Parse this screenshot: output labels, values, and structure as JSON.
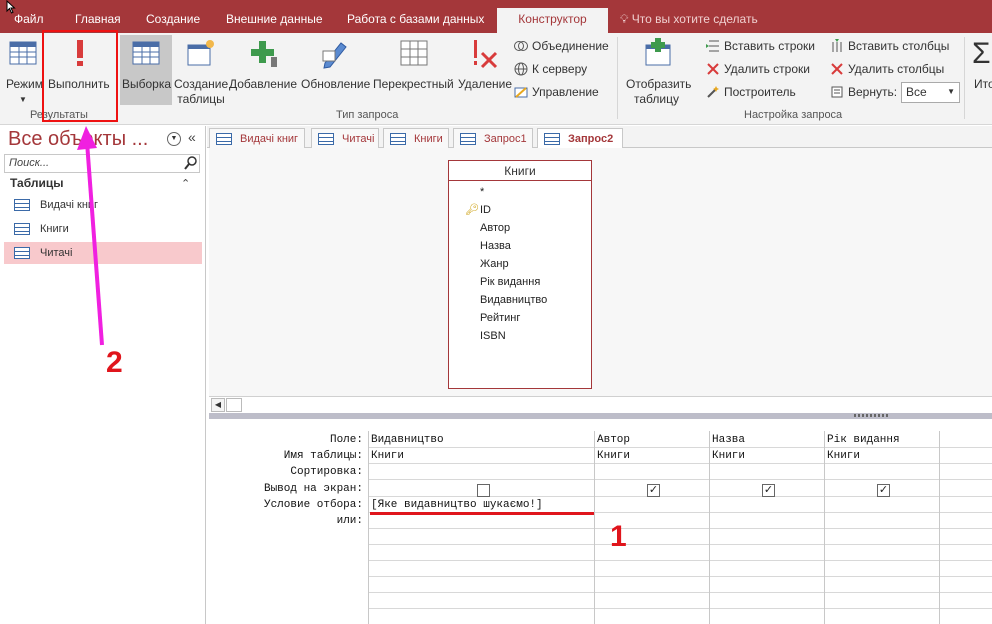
{
  "menu": {
    "tabs": [
      "Файл",
      "Главная",
      "Создание",
      "Внешние данные",
      "Работа с базами данных"
    ],
    "active_tab": "Конструктор",
    "tell_me": "Что вы хотите сделать"
  },
  "ribbon": {
    "results": {
      "view_label": "Режим",
      "run_label": "Выполнить",
      "group": "Результаты"
    },
    "query_type": {
      "select": "Выборка",
      "make_table_1": "Создание",
      "make_table_2": "таблицы",
      "append": "Добавление",
      "update": "Обновление",
      "crosstab": "Перекрестный",
      "delete": "Удаление",
      "union": "Объединение",
      "passthrough": "К серверу",
      "ddl": "Управление",
      "group": "Тип запроса"
    },
    "setup": {
      "show_table_1": "Отобразить",
      "show_table_2": "таблицу",
      "insert_rows": "Вставить строки",
      "delete_rows": "Удалить строки",
      "builder": "Построитель",
      "insert_cols": "Вставить столбцы",
      "delete_cols": "Удалить столбцы",
      "return_label": "Вернуть:",
      "return_value": "Все",
      "group": "Настройка запроса"
    },
    "totals": "Ито"
  },
  "nav": {
    "title": "Все объекты ...",
    "search_placeholder": "Поиск...",
    "section": "Таблицы",
    "items": [
      "Видачі книг",
      "Книги",
      "Читачі"
    ]
  },
  "doc_tabs": [
    "Видачі книг",
    "Читачі",
    "Книги",
    "Запрос1",
    "Запрос2"
  ],
  "table_box": {
    "title": "Книги",
    "fields": [
      "*",
      "ID",
      "Автор",
      "Назва",
      "Жанр",
      "Рік видання",
      "Видавництво",
      "Рейтинг",
      "ISBN"
    ]
  },
  "grid": {
    "row_labels": [
      "Поле:",
      "Имя таблицы:",
      "Сортировка:",
      "Вывод на экран:",
      "Условие отбора:",
      "или:"
    ],
    "columns": [
      {
        "field": "Видавництво",
        "table": "Книги",
        "show": false,
        "criteria": "[Яке видавництво шукаємо!]"
      },
      {
        "field": "Автор",
        "table": "Книги",
        "show": true,
        "criteria": ""
      },
      {
        "field": "Назва",
        "table": "Книги",
        "show": true,
        "criteria": ""
      },
      {
        "field": "Рік видання",
        "table": "Книги",
        "show": true,
        "criteria": ""
      }
    ]
  },
  "annotations": {
    "one": "1",
    "two": "2"
  },
  "colors": {
    "accent": "#a4373a",
    "annotation_red": "#e0151c",
    "annotation_arrow": "#f020e0"
  }
}
